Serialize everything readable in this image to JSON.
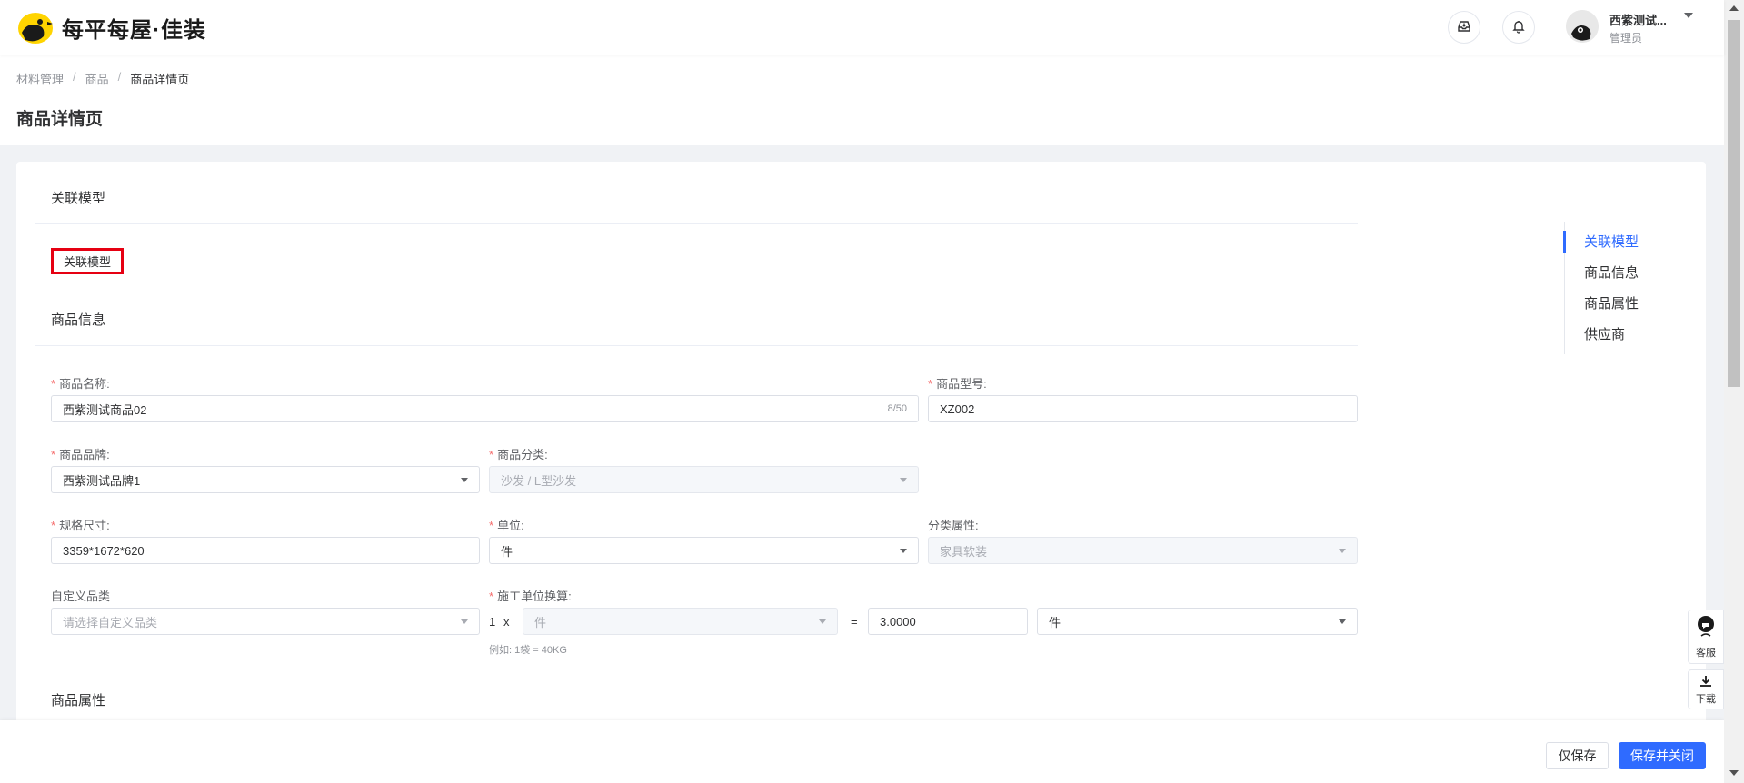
{
  "header": {
    "brand_text": "每平每屋·佳装",
    "user_name": "西紫测试...",
    "user_role": "管理员"
  },
  "breadcrumb": [
    "材料管理",
    "商品",
    "商品详情页"
  ],
  "page_title": "商品详情页",
  "sections": {
    "model_title": "关联模型",
    "model_button": "关联模型",
    "info_title": "商品信息",
    "attr_title": "商品属性"
  },
  "form": {
    "name_label": "商品名称:",
    "name_value": "西紫测试商品02",
    "name_count": "8/50",
    "model_label": "商品型号:",
    "model_value": "XZ002",
    "brand_label": "商品品牌:",
    "brand_value": "西紫测试品牌1",
    "category_label": "商品分类:",
    "category_value": "沙发 / L型沙发",
    "spec_label": "规格尺寸:",
    "spec_value": "3359*1672*620",
    "unit_label": "单位:",
    "unit_value": "件",
    "class_attr_label": "分类属性:",
    "class_attr_value": "家具软装",
    "custom_cat_label": "自定义品类",
    "custom_cat_placeholder": "请选择自定义品类",
    "conv_label": "施工单位换算:",
    "conv_one": "1",
    "conv_x": "x",
    "conv_unit_left": "件",
    "conv_eq": "=",
    "conv_value": "3.0000",
    "conv_unit_right": "件",
    "conv_hint": "例如: 1袋 = 40KG"
  },
  "anchor_nav": [
    "关联模型",
    "商品信息",
    "商品属性",
    "供应商"
  ],
  "floating": {
    "service_label": "客服",
    "download_label": "下载"
  },
  "footer": {
    "save_only": "仅保存",
    "save_close": "保存并关闭"
  },
  "colors": {
    "primary": "#2f6bff",
    "required": "#f56c6c",
    "highlight_box": "#e60012",
    "logo_yellow": "#ffd400"
  }
}
